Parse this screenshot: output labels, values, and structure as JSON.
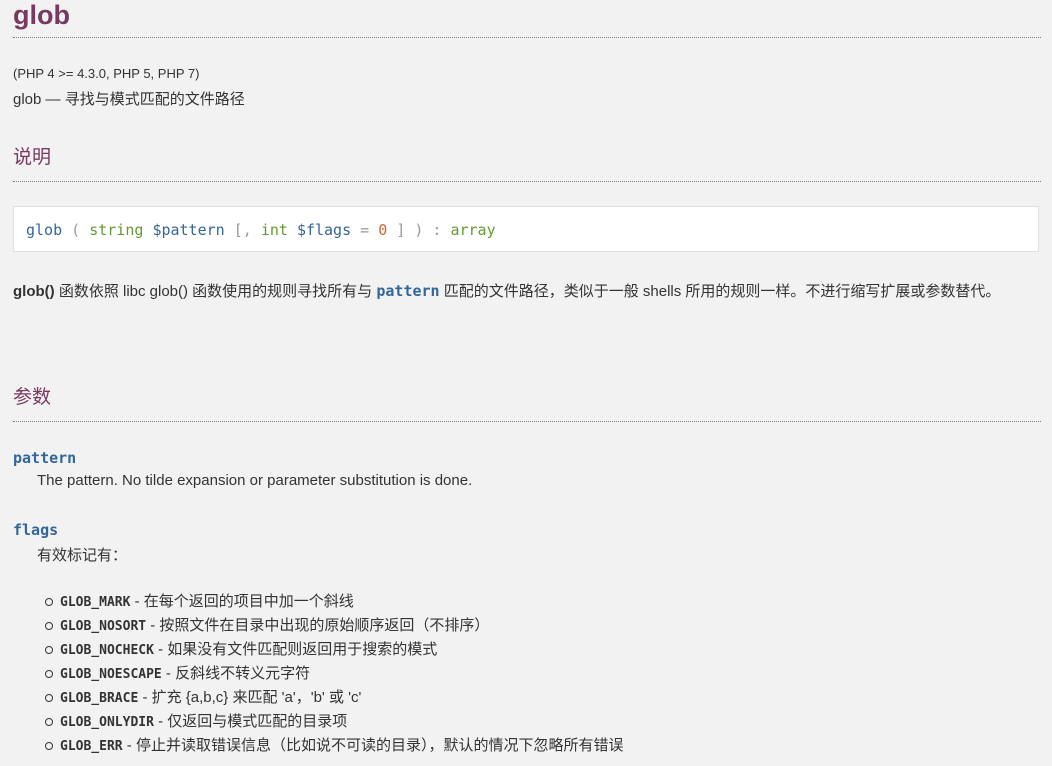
{
  "title": "glob",
  "versions": "(PHP 4 >= 4.3.0, PHP 5, PHP 7)",
  "refpurpose": {
    "name": "glob",
    "dash": " — ",
    "text": "寻找与模式匹配的文件路径"
  },
  "sections": {
    "description": "说明",
    "parameters": "参数"
  },
  "synopsis": {
    "function": "glob",
    "open": " ( ",
    "type1": "string",
    "var1": "$pattern",
    "optional_open": " [, ",
    "type2": "int",
    "var2": "$flags",
    "equals": " = ",
    "default": "0",
    "close": " ] ) : ",
    "return_type": "array"
  },
  "description": {
    "func": "glob()",
    "part1": " 函数依照 libc glob() 函数使用的规则寻找所有与 ",
    "param": "pattern",
    "part2": " 匹配的文件路径，类似于一般 shells 所用的规则一样。不进行缩写扩展或参数替代。"
  },
  "params": {
    "pattern": {
      "name": "pattern",
      "text": "The pattern. No tilde expansion or parameter substitution is done."
    },
    "flags": {
      "name": "flags",
      "text": "有效标记有："
    }
  },
  "flag_list": [
    {
      "name": "GLOB_MARK",
      "text": " - 在每个返回的项目中加一个斜线"
    },
    {
      "name": "GLOB_NOSORT",
      "text": " - 按照文件在目录中出现的原始顺序返回（不排序）"
    },
    {
      "name": "GLOB_NOCHECK",
      "text": " - 如果没有文件匹配则返回用于搜索的模式"
    },
    {
      "name": "GLOB_NOESCAPE",
      "text": " - 反斜线不转义元字符"
    },
    {
      "name": "GLOB_BRACE",
      "text": " - 扩充 {a,b,c} 来匹配 'a'，'b' 或 'c'"
    },
    {
      "name": "GLOB_ONLYDIR",
      "text": " - 仅返回与模式匹配的目录项"
    },
    {
      "name": "GLOB_ERR",
      "text": " - 停止并读取错误信息（比如说不可读的目录），默认的情况下忽略所有错误"
    }
  ],
  "colors": {
    "heading": "#793862",
    "code": "#336699",
    "type": "#669933",
    "number": "#cc6633",
    "background": "#f2f2f2"
  }
}
